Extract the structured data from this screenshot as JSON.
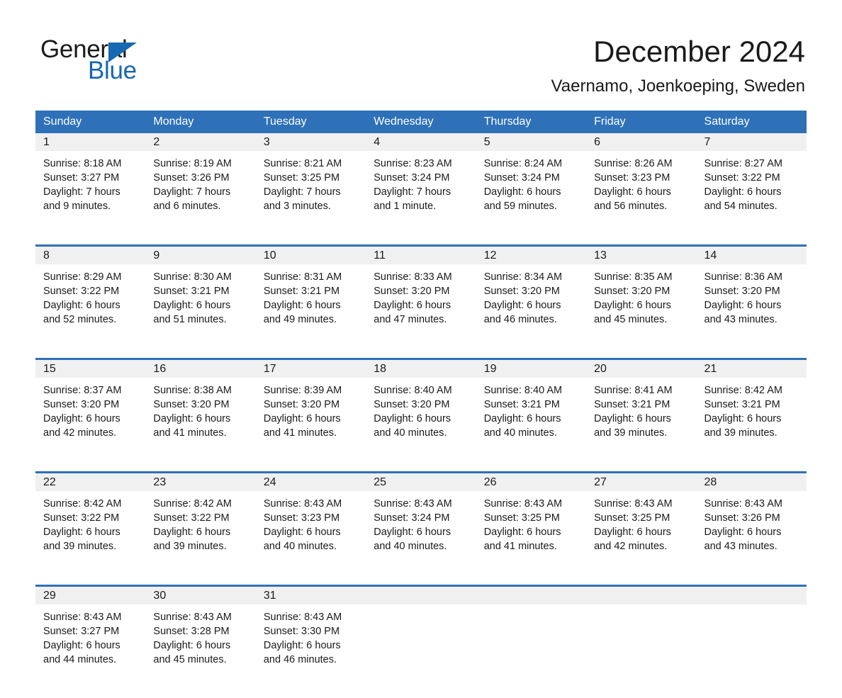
{
  "logo": {
    "line1": "General",
    "line2": "Blue",
    "triangle_icon": "triangle-icon",
    "brand_blue": "#1668b0"
  },
  "header": {
    "title": "December 2024",
    "subtitle": "Vaernamo, Joenkoeping, Sweden"
  },
  "colors": {
    "header_blue": "#2e71b8",
    "daynum_band": "#f0f0f0",
    "text": "#1a1a1a"
  },
  "calendar": {
    "day_names": [
      "Sunday",
      "Monday",
      "Tuesday",
      "Wednesday",
      "Thursday",
      "Friday",
      "Saturday"
    ],
    "weeks": [
      [
        {
          "day": "1",
          "lines": [
            "Sunrise: 8:18 AM",
            "Sunset: 3:27 PM",
            "Daylight: 7 hours",
            "and 9 minutes."
          ]
        },
        {
          "day": "2",
          "lines": [
            "Sunrise: 8:19 AM",
            "Sunset: 3:26 PM",
            "Daylight: 7 hours",
            "and 6 minutes."
          ]
        },
        {
          "day": "3",
          "lines": [
            "Sunrise: 8:21 AM",
            "Sunset: 3:25 PM",
            "Daylight: 7 hours",
            "and 3 minutes."
          ]
        },
        {
          "day": "4",
          "lines": [
            "Sunrise: 8:23 AM",
            "Sunset: 3:24 PM",
            "Daylight: 7 hours",
            "and 1 minute."
          ]
        },
        {
          "day": "5",
          "lines": [
            "Sunrise: 8:24 AM",
            "Sunset: 3:24 PM",
            "Daylight: 6 hours",
            "and 59 minutes."
          ]
        },
        {
          "day": "6",
          "lines": [
            "Sunrise: 8:26 AM",
            "Sunset: 3:23 PM",
            "Daylight: 6 hours",
            "and 56 minutes."
          ]
        },
        {
          "day": "7",
          "lines": [
            "Sunrise: 8:27 AM",
            "Sunset: 3:22 PM",
            "Daylight: 6 hours",
            "and 54 minutes."
          ]
        }
      ],
      [
        {
          "day": "8",
          "lines": [
            "Sunrise: 8:29 AM",
            "Sunset: 3:22 PM",
            "Daylight: 6 hours",
            "and 52 minutes."
          ]
        },
        {
          "day": "9",
          "lines": [
            "Sunrise: 8:30 AM",
            "Sunset: 3:21 PM",
            "Daylight: 6 hours",
            "and 51 minutes."
          ]
        },
        {
          "day": "10",
          "lines": [
            "Sunrise: 8:31 AM",
            "Sunset: 3:21 PM",
            "Daylight: 6 hours",
            "and 49 minutes."
          ]
        },
        {
          "day": "11",
          "lines": [
            "Sunrise: 8:33 AM",
            "Sunset: 3:20 PM",
            "Daylight: 6 hours",
            "and 47 minutes."
          ]
        },
        {
          "day": "12",
          "lines": [
            "Sunrise: 8:34 AM",
            "Sunset: 3:20 PM",
            "Daylight: 6 hours",
            "and 46 minutes."
          ]
        },
        {
          "day": "13",
          "lines": [
            "Sunrise: 8:35 AM",
            "Sunset: 3:20 PM",
            "Daylight: 6 hours",
            "and 45 minutes."
          ]
        },
        {
          "day": "14",
          "lines": [
            "Sunrise: 8:36 AM",
            "Sunset: 3:20 PM",
            "Daylight: 6 hours",
            "and 43 minutes."
          ]
        }
      ],
      [
        {
          "day": "15",
          "lines": [
            "Sunrise: 8:37 AM",
            "Sunset: 3:20 PM",
            "Daylight: 6 hours",
            "and 42 minutes."
          ]
        },
        {
          "day": "16",
          "lines": [
            "Sunrise: 8:38 AM",
            "Sunset: 3:20 PM",
            "Daylight: 6 hours",
            "and 41 minutes."
          ]
        },
        {
          "day": "17",
          "lines": [
            "Sunrise: 8:39 AM",
            "Sunset: 3:20 PM",
            "Daylight: 6 hours",
            "and 41 minutes."
          ]
        },
        {
          "day": "18",
          "lines": [
            "Sunrise: 8:40 AM",
            "Sunset: 3:20 PM",
            "Daylight: 6 hours",
            "and 40 minutes."
          ]
        },
        {
          "day": "19",
          "lines": [
            "Sunrise: 8:40 AM",
            "Sunset: 3:21 PM",
            "Daylight: 6 hours",
            "and 40 minutes."
          ]
        },
        {
          "day": "20",
          "lines": [
            "Sunrise: 8:41 AM",
            "Sunset: 3:21 PM",
            "Daylight: 6 hours",
            "and 39 minutes."
          ]
        },
        {
          "day": "21",
          "lines": [
            "Sunrise: 8:42 AM",
            "Sunset: 3:21 PM",
            "Daylight: 6 hours",
            "and 39 minutes."
          ]
        }
      ],
      [
        {
          "day": "22",
          "lines": [
            "Sunrise: 8:42 AM",
            "Sunset: 3:22 PM",
            "Daylight: 6 hours",
            "and 39 minutes."
          ]
        },
        {
          "day": "23",
          "lines": [
            "Sunrise: 8:42 AM",
            "Sunset: 3:22 PM",
            "Daylight: 6 hours",
            "and 39 minutes."
          ]
        },
        {
          "day": "24",
          "lines": [
            "Sunrise: 8:43 AM",
            "Sunset: 3:23 PM",
            "Daylight: 6 hours",
            "and 40 minutes."
          ]
        },
        {
          "day": "25",
          "lines": [
            "Sunrise: 8:43 AM",
            "Sunset: 3:24 PM",
            "Daylight: 6 hours",
            "and 40 minutes."
          ]
        },
        {
          "day": "26",
          "lines": [
            "Sunrise: 8:43 AM",
            "Sunset: 3:25 PM",
            "Daylight: 6 hours",
            "and 41 minutes."
          ]
        },
        {
          "day": "27",
          "lines": [
            "Sunrise: 8:43 AM",
            "Sunset: 3:25 PM",
            "Daylight: 6 hours",
            "and 42 minutes."
          ]
        },
        {
          "day": "28",
          "lines": [
            "Sunrise: 8:43 AM",
            "Sunset: 3:26 PM",
            "Daylight: 6 hours",
            "and 43 minutes."
          ]
        }
      ],
      [
        {
          "day": "29",
          "lines": [
            "Sunrise: 8:43 AM",
            "Sunset: 3:27 PM",
            "Daylight: 6 hours",
            "and 44 minutes."
          ]
        },
        {
          "day": "30",
          "lines": [
            "Sunrise: 8:43 AM",
            "Sunset: 3:28 PM",
            "Daylight: 6 hours",
            "and 45 minutes."
          ]
        },
        {
          "day": "31",
          "lines": [
            "Sunrise: 8:43 AM",
            "Sunset: 3:30 PM",
            "Daylight: 6 hours",
            "and 46 minutes."
          ]
        },
        {
          "day": "",
          "lines": []
        },
        {
          "day": "",
          "lines": []
        },
        {
          "day": "",
          "lines": []
        },
        {
          "day": "",
          "lines": []
        }
      ]
    ]
  }
}
